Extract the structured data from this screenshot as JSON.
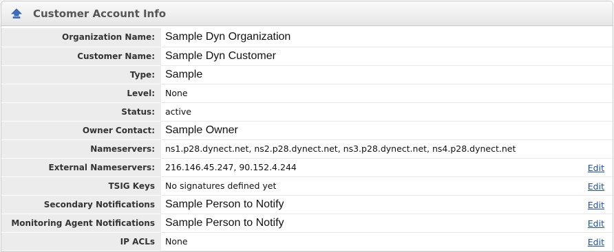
{
  "panel": {
    "title": "Customer Account Info",
    "icon": "collapse-up-arrow-icon",
    "accent": "#3a6fc4"
  },
  "rows": [
    {
      "label": "Organization Name:",
      "value": "Sample Dyn Organization",
      "edit": ""
    },
    {
      "label": "Customer Name:",
      "value": "Sample Dyn Customer",
      "edit": ""
    },
    {
      "label": "Type:",
      "value": "Sample",
      "edit": ""
    },
    {
      "label": "Level:",
      "value": "None",
      "edit": ""
    },
    {
      "label": "Status:",
      "value": "active",
      "edit": ""
    },
    {
      "label": "Owner Contact:",
      "value": "Sample Owner",
      "edit": ""
    },
    {
      "label": "Nameservers:",
      "value": "ns1.p28.dynect.net, ns2.p28.dynect.net, ns3.p28.dynect.net, ns4.p28.dynect.net",
      "edit": ""
    },
    {
      "label": "External Nameservers:",
      "value": "216.146.45.247, 90.152.4.244",
      "edit": "Edit"
    },
    {
      "label": "TSIG Keys",
      "value": "No signatures defined yet",
      "edit": "Edit"
    },
    {
      "label": "Secondary Notifications",
      "value": "Sample Person to Notify",
      "edit": "Edit"
    },
    {
      "label": "Monitoring Agent Notifications",
      "value": "Sample Person to Notify",
      "edit": "Edit"
    },
    {
      "label": "IP ACLs",
      "value": "None",
      "edit": "Edit"
    }
  ],
  "link_color": "#1a4fb0"
}
